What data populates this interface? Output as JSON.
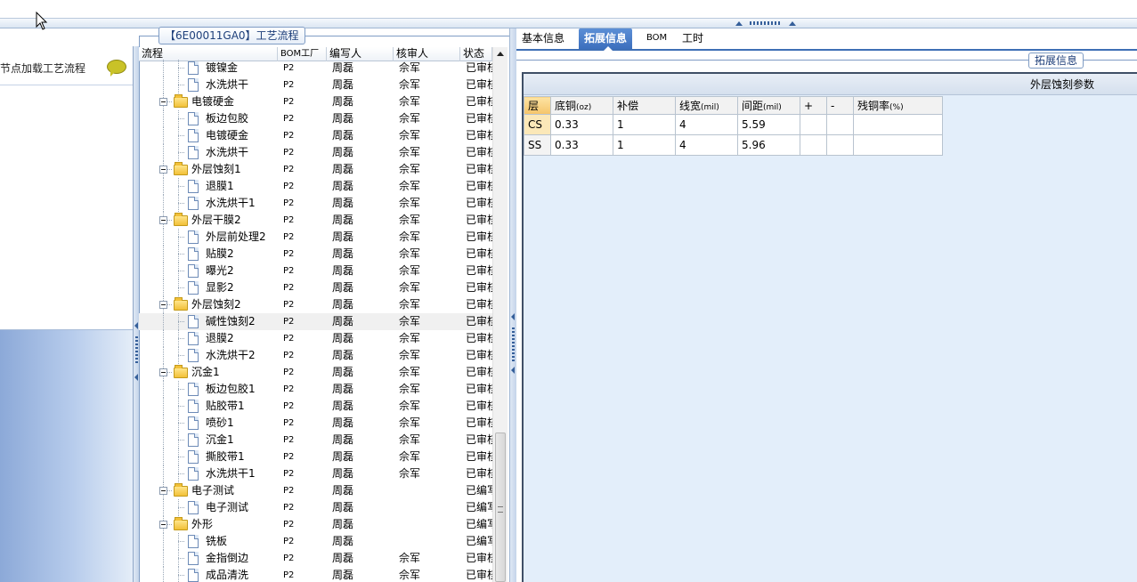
{
  "left_panel": {
    "title": "节点加载工艺流程"
  },
  "tree_panel": {
    "title": "【6E00011GA0】工艺流程",
    "columns": [
      "流程",
      "BOM工厂",
      "编写人",
      "核审人",
      "状态"
    ],
    "rows": [
      {
        "level": 2,
        "type": "doc",
        "name": "镀镍金",
        "factory": "P2",
        "writer": "周磊",
        "reviewer": "佘军",
        "status": "已审核"
      },
      {
        "level": 2,
        "type": "doc",
        "name": "水洗烘干",
        "factory": "P2",
        "writer": "周磊",
        "reviewer": "佘军",
        "status": "已审核"
      },
      {
        "level": 1,
        "type": "folder",
        "name": "电镀硬金",
        "factory": "P2",
        "writer": "周磊",
        "reviewer": "佘军",
        "status": "已审核"
      },
      {
        "level": 2,
        "type": "doc",
        "name": "板边包胶",
        "factory": "P2",
        "writer": "周磊",
        "reviewer": "佘军",
        "status": "已审核"
      },
      {
        "level": 2,
        "type": "doc",
        "name": "电镀硬金",
        "factory": "P2",
        "writer": "周磊",
        "reviewer": "佘军",
        "status": "已审核"
      },
      {
        "level": 2,
        "type": "doc",
        "name": "水洗烘干",
        "factory": "P2",
        "writer": "周磊",
        "reviewer": "佘军",
        "status": "已审核"
      },
      {
        "level": 1,
        "type": "folder",
        "name": "外层蚀刻1",
        "factory": "P2",
        "writer": "周磊",
        "reviewer": "佘军",
        "status": "已审核"
      },
      {
        "level": 2,
        "type": "doc",
        "name": "退膜1",
        "factory": "P2",
        "writer": "周磊",
        "reviewer": "佘军",
        "status": "已审核"
      },
      {
        "level": 2,
        "type": "doc",
        "name": "水洗烘干1",
        "factory": "P2",
        "writer": "周磊",
        "reviewer": "佘军",
        "status": "已审核"
      },
      {
        "level": 1,
        "type": "folder",
        "name": "外层干膜2",
        "factory": "P2",
        "writer": "周磊",
        "reviewer": "佘军",
        "status": "已审核"
      },
      {
        "level": 2,
        "type": "doc",
        "name": "外层前处理2",
        "factory": "P2",
        "writer": "周磊",
        "reviewer": "佘军",
        "status": "已审核"
      },
      {
        "level": 2,
        "type": "doc",
        "name": "贴膜2",
        "factory": "P2",
        "writer": "周磊",
        "reviewer": "佘军",
        "status": "已审核"
      },
      {
        "level": 2,
        "type": "doc",
        "name": "曝光2",
        "factory": "P2",
        "writer": "周磊",
        "reviewer": "佘军",
        "status": "已审核"
      },
      {
        "level": 2,
        "type": "doc",
        "name": "显影2",
        "factory": "P2",
        "writer": "周磊",
        "reviewer": "佘军",
        "status": "已审核"
      },
      {
        "level": 1,
        "type": "folder",
        "name": "外层蚀刻2",
        "factory": "P2",
        "writer": "周磊",
        "reviewer": "佘军",
        "status": "已审核"
      },
      {
        "level": 2,
        "type": "doc",
        "name": "碱性蚀刻2",
        "factory": "P2",
        "writer": "周磊",
        "reviewer": "佘军",
        "status": "已审核",
        "selected": true
      },
      {
        "level": 2,
        "type": "doc",
        "name": "退膜2",
        "factory": "P2",
        "writer": "周磊",
        "reviewer": "佘军",
        "status": "已审核"
      },
      {
        "level": 2,
        "type": "doc",
        "name": "水洗烘干2",
        "factory": "P2",
        "writer": "周磊",
        "reviewer": "佘军",
        "status": "已审核"
      },
      {
        "level": 1,
        "type": "folder",
        "name": "沉金1",
        "factory": "P2",
        "writer": "周磊",
        "reviewer": "佘军",
        "status": "已审核"
      },
      {
        "level": 2,
        "type": "doc",
        "name": "板边包胶1",
        "factory": "P2",
        "writer": "周磊",
        "reviewer": "佘军",
        "status": "已审核"
      },
      {
        "level": 2,
        "type": "doc",
        "name": "贴胶带1",
        "factory": "P2",
        "writer": "周磊",
        "reviewer": "佘军",
        "status": "已审核"
      },
      {
        "level": 2,
        "type": "doc",
        "name": "喷砂1",
        "factory": "P2",
        "writer": "周磊",
        "reviewer": "佘军",
        "status": "已审核"
      },
      {
        "level": 2,
        "type": "doc",
        "name": "沉金1",
        "factory": "P2",
        "writer": "周磊",
        "reviewer": "佘军",
        "status": "已审核"
      },
      {
        "level": 2,
        "type": "doc",
        "name": "撕胶带1",
        "factory": "P2",
        "writer": "周磊",
        "reviewer": "佘军",
        "status": "已审核"
      },
      {
        "level": 2,
        "type": "doc",
        "name": "水洗烘干1",
        "factory": "P2",
        "writer": "周磊",
        "reviewer": "佘军",
        "status": "已审核"
      },
      {
        "level": 1,
        "type": "folder",
        "name": "电子测试",
        "factory": "P2",
        "writer": "周磊",
        "reviewer": "",
        "status": "已编写"
      },
      {
        "level": 2,
        "type": "doc",
        "name": "电子测试",
        "factory": "P2",
        "writer": "周磊",
        "reviewer": "",
        "status": "已编写"
      },
      {
        "level": 1,
        "type": "folder",
        "name": "外形",
        "factory": "P2",
        "writer": "周磊",
        "reviewer": "",
        "status": "已编写"
      },
      {
        "level": 2,
        "type": "doc",
        "name": "铣板",
        "factory": "P2",
        "writer": "周磊",
        "reviewer": "",
        "status": "已编写"
      },
      {
        "level": 2,
        "type": "doc",
        "name": "金指倒边",
        "factory": "P2",
        "writer": "周磊",
        "reviewer": "佘军",
        "status": "已审核"
      },
      {
        "level": 2,
        "type": "doc",
        "name": "成品清洗",
        "factory": "P2",
        "writer": "周磊",
        "reviewer": "佘军",
        "status": "已审核"
      }
    ]
  },
  "right_panel": {
    "tabs": [
      {
        "label": "基本信息",
        "active": false
      },
      {
        "label": "拓展信息",
        "active": true
      },
      {
        "label": "BOM",
        "active": false
      },
      {
        "label": "工时",
        "active": false
      }
    ],
    "section_button": "拓展信息",
    "grid_caption": "外层蚀刻参数",
    "grid_columns": [
      {
        "label": "层",
        "unit": ""
      },
      {
        "label": "底铜",
        "unit": "(oz)"
      },
      {
        "label": "补偿",
        "unit": ""
      },
      {
        "label": "线宽",
        "unit": "(mil)"
      },
      {
        "label": "间距",
        "unit": "(mil)"
      },
      {
        "label": "+",
        "unit": ""
      },
      {
        "label": "-",
        "unit": ""
      },
      {
        "label": "残铜率",
        "unit": "(%)"
      }
    ],
    "grid_rows": [
      {
        "layer": "CS",
        "base_copper": "0.33",
        "compensation": "1",
        "line_width": "4",
        "spacing": "5.59",
        "plus": "",
        "minus": "",
        "residual": ""
      },
      {
        "layer": "SS",
        "base_copper": "0.33",
        "compensation": "1",
        "line_width": "4",
        "spacing": "5.96",
        "plus": "",
        "minus": "",
        "residual": ""
      }
    ]
  },
  "colors": {
    "accent": "#3c6fbd",
    "border": "#7f9cc4",
    "panel_bg": "#e3eefa",
    "bubble": "#c9c228"
  }
}
